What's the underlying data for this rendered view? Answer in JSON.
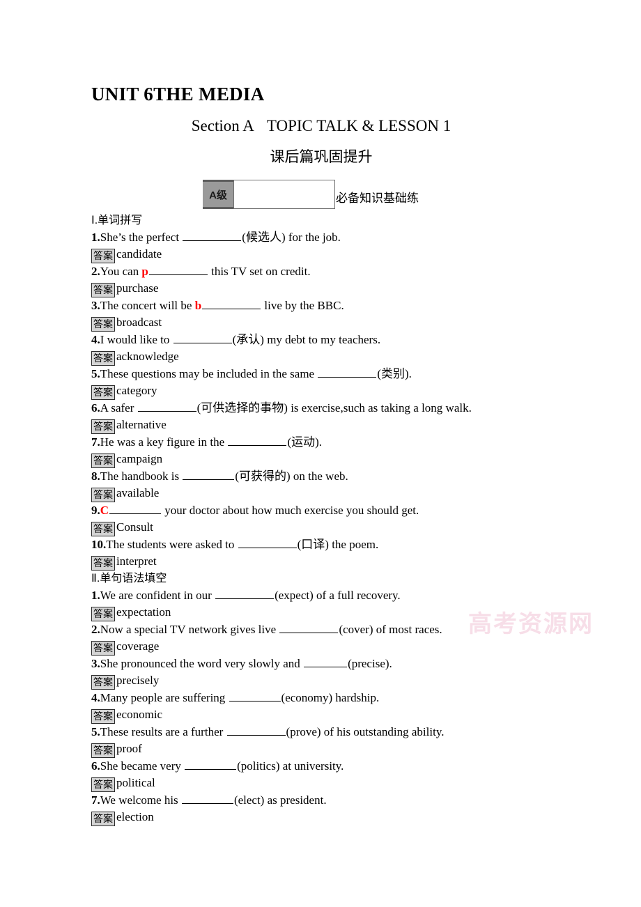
{
  "document": {
    "unit_title": "UNIT 6THE MEDIA",
    "section_title_left": "Section A",
    "section_title_right": "TOPIC TALK & LESSON 1",
    "sub_title": "课后篇巩固提升",
    "watermark": "高考资源网"
  },
  "level_banner": {
    "badge": "A级",
    "label": "必备知识基础练"
  },
  "parts": [
    {
      "heading": "Ⅰ.单词拼写",
      "items": [
        {
          "num": "1.",
          "before": "She’s the perfect ",
          "hint": "",
          "blank": "w-lg",
          "after": "(候选人) for the job.",
          "answer_tag": "答案",
          "answer": "candidate"
        },
        {
          "num": "2.",
          "before": "You can ",
          "hint": "p",
          "blank": "w-lg",
          "after": " this TV set on credit.",
          "answer_tag": "答案",
          "answer": "purchase"
        },
        {
          "num": "3.",
          "before": "The concert will be ",
          "hint": "b",
          "blank": "w-lg",
          "after": " live by the BBC.",
          "answer_tag": "答案",
          "answer": "broadcast"
        },
        {
          "num": "4.",
          "before": "I would like to ",
          "hint": "",
          "blank": "w-lg",
          "after": "(承认) my debt to my teachers.",
          "answer_tag": "答案",
          "answer": "acknowledge"
        },
        {
          "num": "5.",
          "before": "These questions may be included in the same ",
          "hint": "",
          "blank": "w-lg",
          "after": "(类别).",
          "answer_tag": "答案",
          "answer": "category"
        },
        {
          "num": "6.",
          "before": "A safer ",
          "hint": "",
          "blank": "w-lg",
          "after": "(可供选择的事物) is exercise,such as taking a long walk.",
          "answer_tag": "答案",
          "answer": "alternative"
        },
        {
          "num": "7.",
          "before": "He was a key figure in the ",
          "hint": "",
          "blank": "w-lg",
          "after": "(运动).",
          "answer_tag": "答案",
          "answer": "campaign"
        },
        {
          "num": "8.",
          "before": "The handbook is ",
          "hint": "",
          "blank": "w-md",
          "after": "(可获得的) on the web.",
          "answer_tag": "答案",
          "answer": "available"
        },
        {
          "num": "9.",
          "before": "",
          "hint": "C",
          "blank": "w-md",
          "after": " your doctor about how much exercise you should get.",
          "answer_tag": "答案",
          "answer": "Consult"
        },
        {
          "num": "10.",
          "before": "The students were asked to ",
          "hint": "",
          "blank": "w-lg",
          "after": "(口译) the poem.",
          "answer_tag": "答案",
          "answer": "interpret"
        }
      ]
    },
    {
      "heading": "Ⅱ.单句语法填空",
      "items": [
        {
          "num": "1.",
          "before": "We are confident in our ",
          "hint": "",
          "blank": "w-lg",
          "after": "(expect) of a full recovery.",
          "answer_tag": "答案",
          "answer": "expectation"
        },
        {
          "num": "2.",
          "before": "Now a special TV network gives live ",
          "hint": "",
          "blank": "w-lg",
          "after": "(cover) of most races.",
          "answer_tag": "答案",
          "answer": "coverage"
        },
        {
          "num": "3.",
          "before": "She pronounced the word very slowly and ",
          "hint": "",
          "blank": "w-sm",
          "after": "(precise).",
          "answer_tag": "答案",
          "answer": "precisely"
        },
        {
          "num": "4.",
          "before": "Many people are suffering ",
          "hint": "",
          "blank": "w-md",
          "after": "(economy) hardship.",
          "answer_tag": "答案",
          "answer": "economic"
        },
        {
          "num": "5.",
          "before": "These results are a further ",
          "hint": "",
          "blank": "w-lg",
          "after": "(prove) of his outstanding ability.",
          "answer_tag": "答案",
          "answer": "proof"
        },
        {
          "num": "6.",
          "before": "She became very ",
          "hint": "",
          "blank": "w-md",
          "after": "(politics) at university.",
          "answer_tag": "答案",
          "answer": "political"
        },
        {
          "num": "7.",
          "before": "We welcome his ",
          "hint": "",
          "blank": "w-md",
          "after": "(elect) as president.",
          "answer_tag": "答案",
          "answer": "election"
        }
      ]
    }
  ]
}
